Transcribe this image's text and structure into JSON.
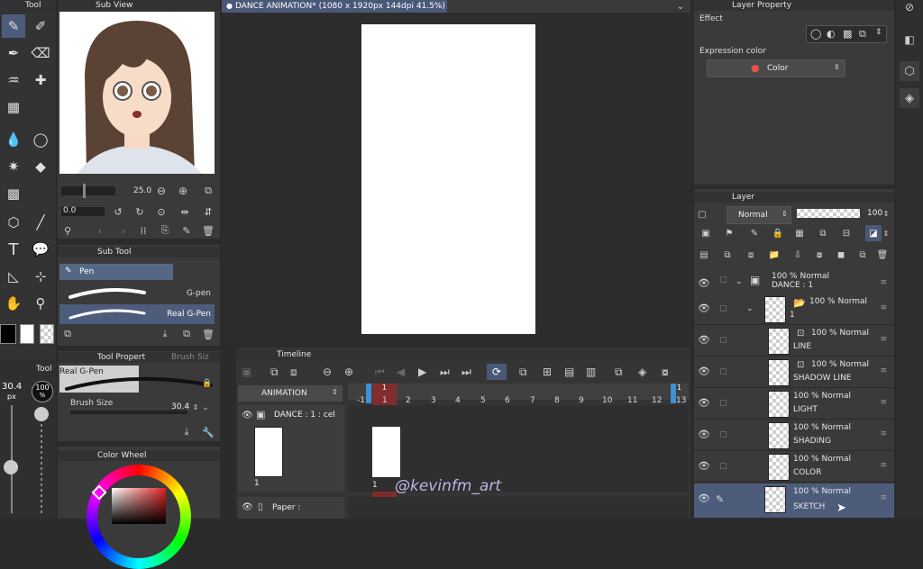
{
  "panels": {
    "tool": "Tool",
    "sub_view": "Sub View",
    "sub_tool": "Sub Tool",
    "tool_property": "Tool Propert",
    "brush_size_tab": "Brush Siz",
    "color_wheel": "Color Wheel",
    "layer_property": "Layer Property",
    "layer": "Layer",
    "timeline": "Timeline",
    "tool_small": "Tool"
  },
  "canvas_tab": "DANCE ANIMATION* (1080 x 1920px 144dpi 41.5%)",
  "navigator": {
    "zoom": "25.0",
    "rotate": "0.0"
  },
  "subtool": {
    "group": "Pen",
    "items": [
      "G-pen",
      "Real G-Pen"
    ]
  },
  "tool_property": {
    "brush_name": "Real G-Pen",
    "brush_size_label": "Brush Size",
    "brush_size_value": "30.4"
  },
  "brush_indicator": {
    "size": "30.4",
    "unit": "px",
    "opacity": "100",
    "opacity_unit": "%"
  },
  "layer_property": {
    "effect": "Effect",
    "expression_color": "Expression color",
    "color_mode": "Color"
  },
  "layer_panel": {
    "blend_mode": "Normal",
    "opacity": "100"
  },
  "layers": [
    {
      "pct": "100 %",
      "mode": "Normal",
      "name": "DANCE : 1",
      "kind": "folder"
    },
    {
      "pct": "100 %",
      "mode": "Normal",
      "name": "1",
      "kind": "folder"
    },
    {
      "pct": "100 %",
      "mode": "Normal",
      "name": "LINE",
      "kind": "raster"
    },
    {
      "pct": "100 %",
      "mode": "Normal",
      "name": "SHADOW LINE",
      "kind": "raster"
    },
    {
      "pct": "100 %",
      "mode": "Normal",
      "name": "LIGHT",
      "kind": "raster"
    },
    {
      "pct": "100 %",
      "mode": "Normal",
      "name": "SHADING",
      "kind": "raster"
    },
    {
      "pct": "100 %",
      "mode": "Normal",
      "name": "COLOR",
      "kind": "raster"
    },
    {
      "pct": "100 %",
      "mode": "Normal",
      "name": "SKETCH",
      "kind": "raster"
    }
  ],
  "timeline": {
    "name": "ANIMATION",
    "track1": "DANCE : 1 : cel",
    "track2": "Paper :",
    "cel_label": "1",
    "playhead": "1",
    "frames": [
      "-1",
      "1",
      "2",
      "3",
      "4",
      "5",
      "6",
      "7",
      "8",
      "9",
      "10",
      "11",
      "12",
      "13"
    ],
    "end_marker": "1"
  },
  "watermark": "@kevinfm_art",
  "colors": {
    "accent": "#3d8fd6",
    "playhead": "#a83232",
    "selected": "#4d5c7a"
  }
}
